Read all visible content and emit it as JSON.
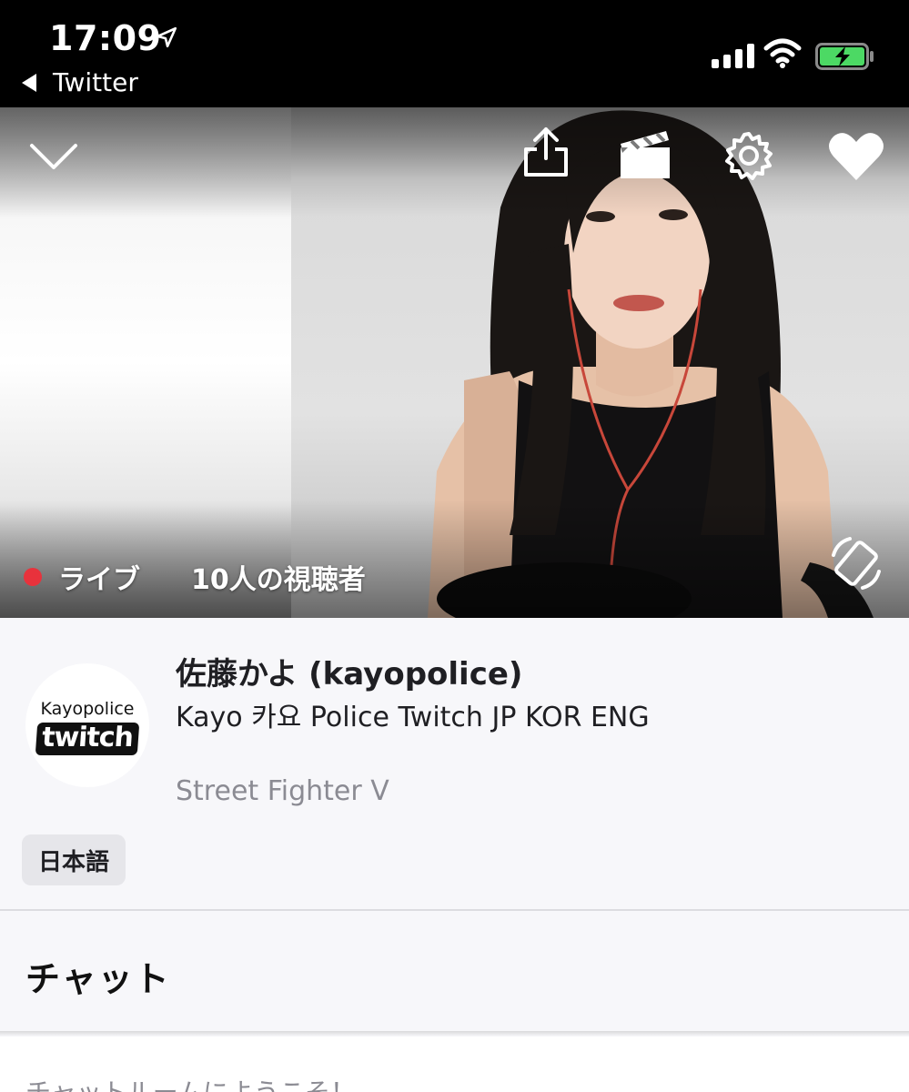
{
  "status_bar": {
    "time": "17:09",
    "back_label": "Twitter",
    "icons": [
      "location-arrow-icon",
      "cell-signal-icon",
      "wifi-icon",
      "battery-charging-icon"
    ]
  },
  "video": {
    "icons": [
      "chevron-down-icon",
      "share-icon",
      "clapperboard-icon",
      "gear-icon",
      "heart-icon",
      "rotate-screen-icon"
    ],
    "live_label": "ライブ",
    "viewer_count": "10人の視聴者",
    "live_color": "#e8323c"
  },
  "channel": {
    "avatar_text": "Kayopolice",
    "avatar_logo": "twitch",
    "name": "佐藤かよ (kayopolice)",
    "title": "Kayo  카요 Police Twitch JP KOR ENG",
    "game": "Street Fighter V",
    "tag": "日本語"
  },
  "chat": {
    "title": "チャット",
    "welcome": "チャットルームにようこそ！"
  }
}
